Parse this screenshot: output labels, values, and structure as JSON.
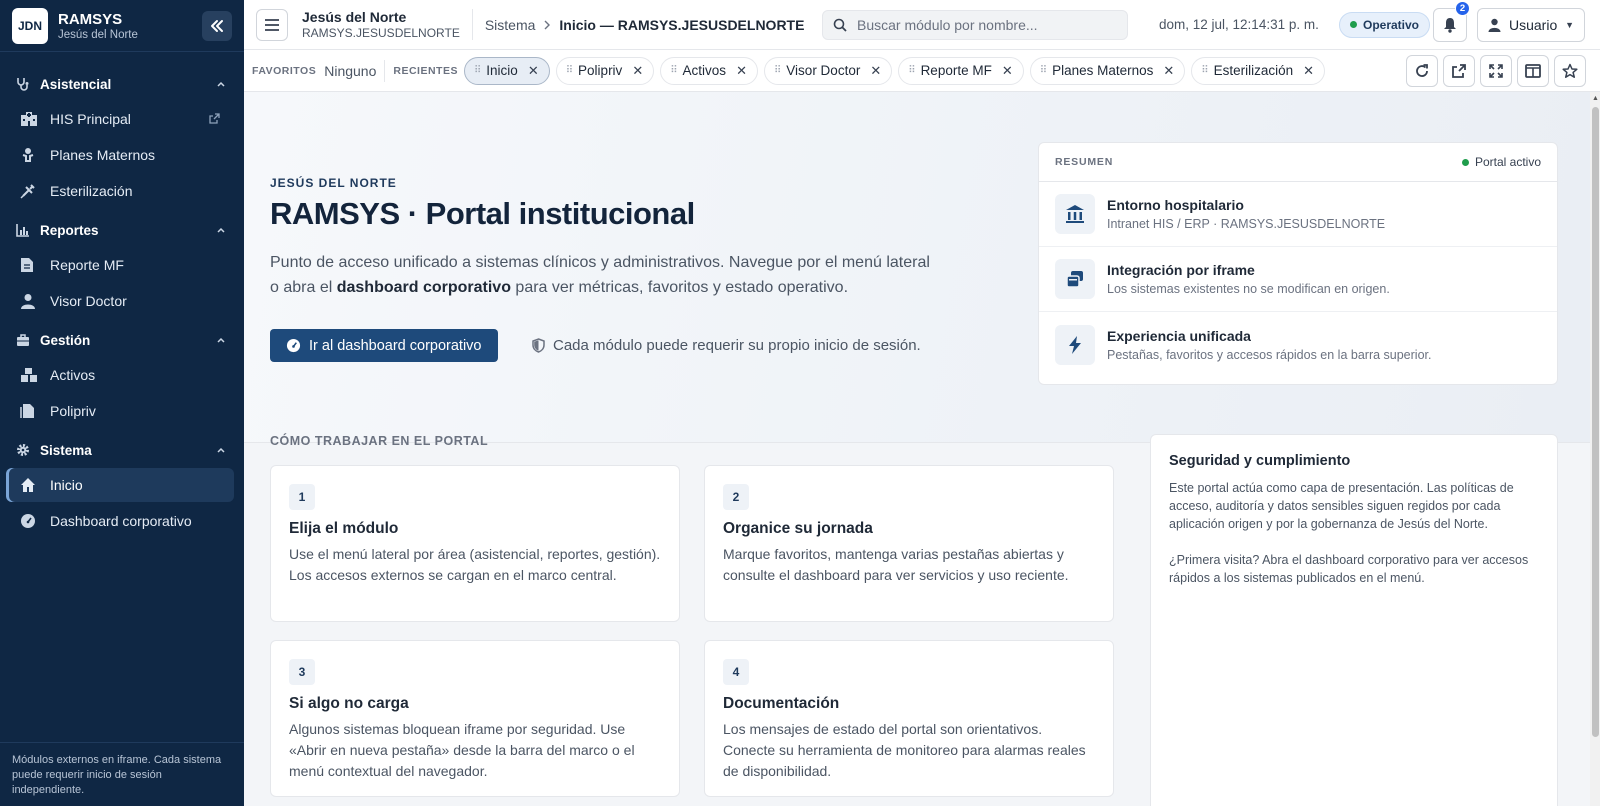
{
  "sidebar": {
    "logo": "JDN",
    "brand_title": "RAMSYS",
    "brand_sub": "Jesús del Norte",
    "sections": [
      {
        "title": "Asistencial",
        "items": [
          "HIS Principal",
          "Planes Maternos",
          "Esterilización"
        ]
      },
      {
        "title": "Reportes",
        "items": [
          "Reporte MF",
          "Visor Doctor"
        ]
      },
      {
        "title": "Gestión",
        "items": [
          "Activos",
          "Polipriv"
        ]
      },
      {
        "title": "Sistema",
        "items": [
          "Inicio",
          "Dashboard corporativo"
        ]
      }
    ],
    "footer": "Módulos externos en iframe. Cada sistema puede requerir inicio de sesión independiente."
  },
  "header": {
    "org_name": "Jesús del Norte",
    "org_code": "RAMSYS.JESUSDELNORTE",
    "breadcrumb_parent": "Sistema",
    "breadcrumb_current": "Inicio — RAMSYS.JESUSDELNORTE",
    "search_placeholder": "Buscar módulo por nombre...",
    "clock": "dom, 12 jul, 12:14:31 p. m.",
    "status": "Operativo",
    "notifications": "2",
    "user": "Usuario"
  },
  "tabsbar": {
    "favorites_label": "FAVORITOS",
    "favorites_value": "Ninguno",
    "recent_label": "RECIENTES",
    "tabs": [
      "Inicio",
      "Polipriv",
      "Activos",
      "Visor Doctor",
      "Reporte MF",
      "Planes Maternos",
      "Esterilización"
    ]
  },
  "hero": {
    "eyebrow": "JESÚS DEL NORTE",
    "title": "RAMSYS · Portal institucional",
    "lead_part1": "Punto de acceso unificado a sistemas clínicos y administrativos. Navegue por el menú lateral o abra el ",
    "lead_strong": "dashboard corporativo",
    "lead_part2": " para ver métricas, favoritos y estado operativo.",
    "cta": "Ir al dashboard corporativo",
    "note": "Cada módulo puede requerir su propio inicio de sesión."
  },
  "summary": {
    "title": "RESUMEN",
    "status": "Portal activo",
    "rows": [
      {
        "title": "Entorno hospitalario",
        "sub": "Intranet HIS / ERP · RAMSYS.JESUSDELNORTE"
      },
      {
        "title": "Integración por iframe",
        "sub": "Los sistemas existentes no se modifican en origen."
      },
      {
        "title": "Experiencia unificada",
        "sub": "Pestañas, favoritos y accesos rápidos en la barra superior."
      }
    ]
  },
  "how": {
    "title": "CÓMO TRABAJAR EN EL PORTAL",
    "steps": [
      {
        "num": "1",
        "title": "Elija el módulo",
        "body": "Use el menú lateral por área (asistencial, reportes, gestión). Los accesos externos se cargan en el marco central."
      },
      {
        "num": "2",
        "title": "Organice su jornada",
        "body": "Marque favoritos, mantenga varias pestañas abiertas y consulte el dashboard para ver servicios y uso reciente."
      },
      {
        "num": "3",
        "title": "Si algo no carga",
        "body": "Algunos sistemas bloquean iframe por seguridad. Use «Abrir en nueva pestaña» desde la barra del marco o el menú contextual del navegador."
      },
      {
        "num": "4",
        "title": "Documentación",
        "body": "Los mensajes de estado del portal son orientativos. Conecte su herramienta de monitoreo para alarmas reales de disponibilidad."
      }
    ]
  },
  "security": {
    "title": "Seguridad y cumplimiento",
    "p1": "Este portal actúa como capa de presentación. Las políticas de acceso, auditoría y datos sensibles siguen regidos por cada aplicación origen y por la gobernanza de Jesús del Norte.",
    "p2": "¿Primera visita? Abra el dashboard corporativo para ver accesos rápidos a los sistemas publicados en el menú."
  },
  "colors": {
    "sidebar_bg": "#0f2744",
    "accent": "#1e4a7b",
    "status_green": "#1f9d4c",
    "badge_blue": "#2563eb"
  }
}
